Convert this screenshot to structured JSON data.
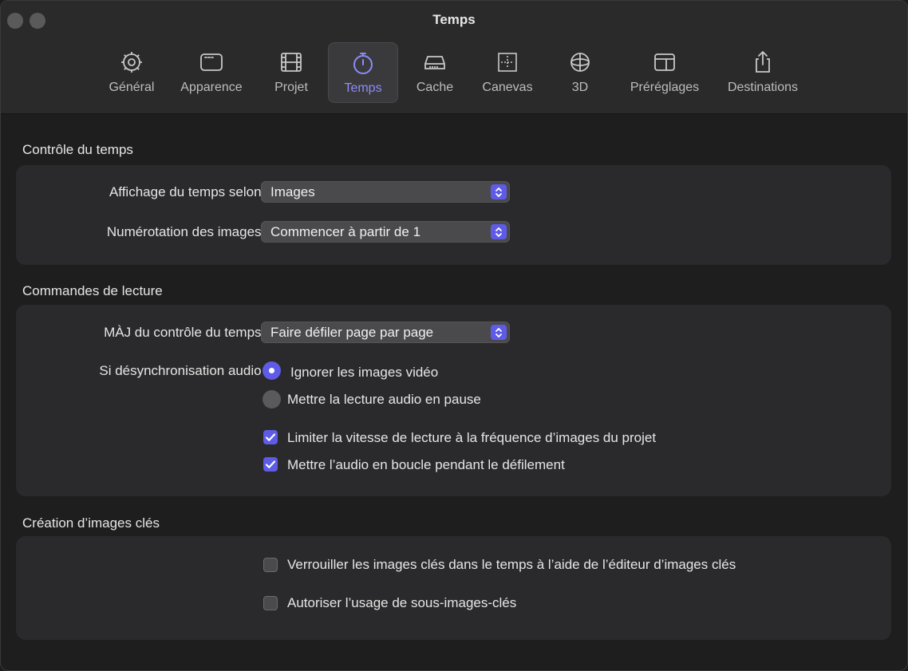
{
  "window": {
    "title": "Temps"
  },
  "tabs": [
    {
      "label": "Général",
      "icon": "gear-icon"
    },
    {
      "label": "Apparence",
      "icon": "window-icon"
    },
    {
      "label": "Projet",
      "icon": "film-icon"
    },
    {
      "label": "Temps",
      "icon": "stopwatch-icon",
      "active": true
    },
    {
      "label": "Cache",
      "icon": "drive-icon"
    },
    {
      "label": "Canevas",
      "icon": "canvas-grid-icon"
    },
    {
      "label": "3D",
      "icon": "sphere-icon"
    },
    {
      "label": "Préréglages",
      "icon": "presets-icon"
    },
    {
      "label": "Destinations",
      "icon": "share-icon"
    }
  ],
  "time_control": {
    "title": "Contrôle du temps",
    "display_label": "Affichage du temps selon :",
    "display_value": "Images",
    "numbering_label": "Numérotation des images :",
    "numbering_value": "Commencer à partir de 1"
  },
  "playback": {
    "title": "Commandes de lecture",
    "update_label": "MÀJ du contrôle du temps :",
    "update_value": "Faire défiler page par page",
    "desync_label": "Si désynchronisation audio :",
    "radio_skip": "Ignorer les images vidéo",
    "radio_pause": "Mettre la lecture audio en pause",
    "check_limit": "Limiter la vitesse de lecture à la fréquence d’images du projet",
    "check_loop": "Mettre l’audio en boucle pendant le défilement"
  },
  "keyframes": {
    "title": "Création d’images clés",
    "check_lock": "Verrouiller les images clés dans le temps à l’aide de l’éditeur d’images clés",
    "check_sub": "Autoriser l’usage de sous-images-clés"
  },
  "colors": {
    "accent": "#5e5ce6",
    "active_tab_label": "#8e8cf8"
  }
}
